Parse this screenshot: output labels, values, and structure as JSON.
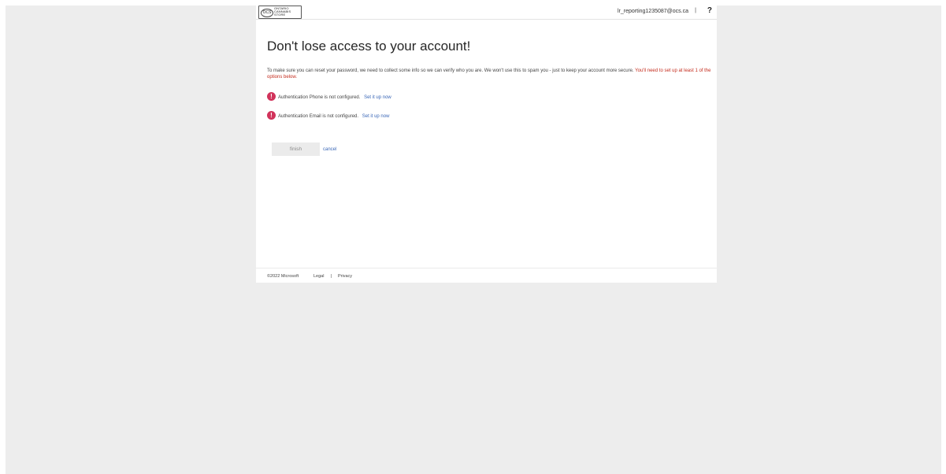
{
  "header": {
    "logo": {
      "mark": "OCS",
      "wordmark": [
        "ONTARIO",
        "CANNABIS",
        "STORE"
      ]
    },
    "user_email": "lr_reporting1235087@ocs.ca",
    "separator": "|",
    "help_label": "?"
  },
  "main": {
    "title": "Don't lose access to your account!",
    "intro": "To make sure you can reset your password, we need to collect some info so we can verify who you are. We won't use this to spam you - just to keep your account more secure.",
    "requirement": "You'll need to set up at least 1 of the options below.",
    "items": [
      {
        "icon": "alert-icon",
        "text": "Authentication Phone is not configured.",
        "link": "Set it up now"
      },
      {
        "icon": "alert-icon",
        "text": "Authentication Email is not configured.",
        "link": "Set it up now"
      }
    ],
    "finish_label": "finish",
    "cancel_label": "cancel"
  },
  "footer": {
    "copyright": "©2022 Microsoft",
    "legal": "Legal",
    "separator": "|",
    "privacy": "Privacy"
  },
  "colors": {
    "background": "#ededed",
    "alert": "#d1335b",
    "link": "#3a67b7",
    "required_text": "#c42b1c"
  }
}
